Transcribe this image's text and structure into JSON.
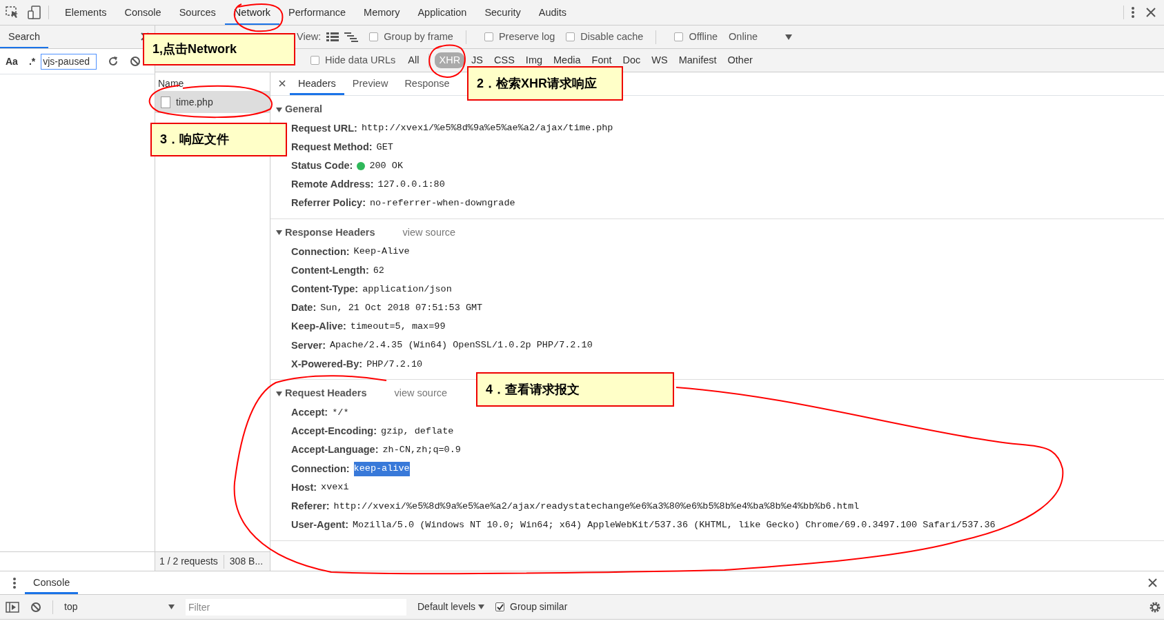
{
  "devtools_tabs": [
    {
      "label": "Elements",
      "selected": false
    },
    {
      "label": "Console",
      "selected": false
    },
    {
      "label": "Sources",
      "selected": false
    },
    {
      "label": "Network",
      "selected": true
    },
    {
      "label": "Performance",
      "selected": false
    },
    {
      "label": "Memory",
      "selected": false
    },
    {
      "label": "Application",
      "selected": false
    },
    {
      "label": "Security",
      "selected": false
    },
    {
      "label": "Audits",
      "selected": false
    }
  ],
  "search_panel": {
    "title": "Search",
    "case_toggle": "Aa",
    "regex_toggle": ".*",
    "query": "vjs-paused"
  },
  "network_toolbar": {
    "view_label": "View:",
    "options": [
      {
        "label": "Group by frame",
        "checked": false
      },
      {
        "label": "Preserve log",
        "checked": false
      },
      {
        "label": "Disable cache",
        "checked": false
      },
      {
        "label": "Offline",
        "checked": false
      }
    ],
    "throttle": "Online"
  },
  "filters": {
    "hide_data_urls": {
      "label": "Hide data URLs",
      "checked": false
    },
    "types": [
      {
        "label": "All",
        "selected": false
      },
      {
        "label": "XHR",
        "selected": true
      },
      {
        "label": "JS",
        "selected": false
      },
      {
        "label": "CSS",
        "selected": false
      },
      {
        "label": "Img",
        "selected": false
      },
      {
        "label": "Media",
        "selected": false
      },
      {
        "label": "Font",
        "selected": false
      },
      {
        "label": "Doc",
        "selected": false
      },
      {
        "label": "WS",
        "selected": false
      },
      {
        "label": "Manifest",
        "selected": false
      },
      {
        "label": "Other",
        "selected": false
      }
    ]
  },
  "requests": {
    "column": "Name",
    "rows": [
      {
        "name": "time.php",
        "selected": true
      }
    ],
    "summary": "1 / 2 requests",
    "transferred": "308 B..."
  },
  "detail_tabs": [
    {
      "label": "Headers",
      "selected": true
    },
    {
      "label": "Preview",
      "selected": false
    },
    {
      "label": "Response",
      "selected": false
    }
  ],
  "sections": [
    {
      "title": "General",
      "expanded": true,
      "rows": [
        {
          "key": "Request URL:",
          "value": "http://xvexi/%e5%8d%9a%e5%ae%a2/ajax/time.php",
          "kind": "text",
          "highlighted": false
        },
        {
          "key": "Request Method:",
          "value": "GET",
          "kind": "text",
          "highlighted": false
        },
        {
          "key": "Status Code:",
          "value": "200 OK",
          "kind": "status",
          "highlighted": false
        },
        {
          "key": "Remote Address:",
          "value": "127.0.0.1:80",
          "kind": "text",
          "highlighted": false
        },
        {
          "key": "Referrer Policy:",
          "value": "no-referrer-when-downgrade",
          "kind": "text",
          "highlighted": false
        }
      ]
    },
    {
      "title": "Response Headers",
      "expanded": true,
      "link": "view source",
      "rows": [
        {
          "key": "Connection:",
          "value": "Keep-Alive",
          "kind": "text",
          "highlighted": false
        },
        {
          "key": "Content-Length:",
          "value": "62",
          "kind": "text",
          "highlighted": false
        },
        {
          "key": "Content-Type:",
          "value": "application/json",
          "kind": "text",
          "highlighted": false
        },
        {
          "key": "Date:",
          "value": "Sun, 21 Oct 2018 07:51:53 GMT",
          "kind": "text",
          "highlighted": false
        },
        {
          "key": "Keep-Alive:",
          "value": "timeout=5, max=99",
          "kind": "text",
          "highlighted": false
        },
        {
          "key": "Server:",
          "value": "Apache/2.4.35 (Win64) OpenSSL/1.0.2p PHP/7.2.10",
          "kind": "text",
          "highlighted": false
        },
        {
          "key": "X-Powered-By:",
          "value": "PHP/7.2.10",
          "kind": "text",
          "highlighted": false
        }
      ]
    },
    {
      "title": "Request Headers",
      "expanded": true,
      "link": "view source",
      "rows": [
        {
          "key": "Accept:",
          "value": "*/*",
          "kind": "text",
          "highlighted": false
        },
        {
          "key": "Accept-Encoding:",
          "value": "gzip, deflate",
          "kind": "text",
          "highlighted": false
        },
        {
          "key": "Accept-Language:",
          "value": "zh-CN,zh;q=0.9",
          "kind": "text",
          "highlighted": false
        },
        {
          "key": "Connection:",
          "value": "keep-alive",
          "kind": "text",
          "highlighted": true
        },
        {
          "key": "Host:",
          "value": "xvexi",
          "kind": "text",
          "highlighted": false
        },
        {
          "key": "Referer:",
          "value": "http://xvexi/%e5%8d%9a%e5%ae%a2/ajax/readystatechange%e6%a3%80%e6%b5%8b%e4%ba%8b%e4%bb%b6.html",
          "kind": "text",
          "highlighted": false
        },
        {
          "key": "User-Agent:",
          "value": "Mozilla/5.0 (Windows NT 10.0; Win64; x64) AppleWebKit/537.36 (KHTML, like Gecko) Chrome/69.0.3497.100 Safari/537.36",
          "kind": "text",
          "highlighted": false
        }
      ]
    }
  ],
  "console_drawer": {
    "tab": "Console",
    "context": "top",
    "filter_placeholder": "Filter",
    "levels": "Default levels",
    "group_similar": {
      "label": "Group similar",
      "checked": true
    }
  },
  "annotations": [
    {
      "text": "1,点击Network"
    },
    {
      "text": "2．检索XHR请求响应"
    },
    {
      "text": "3．响应文件"
    },
    {
      "text": "4．查看请求报文"
    }
  ]
}
